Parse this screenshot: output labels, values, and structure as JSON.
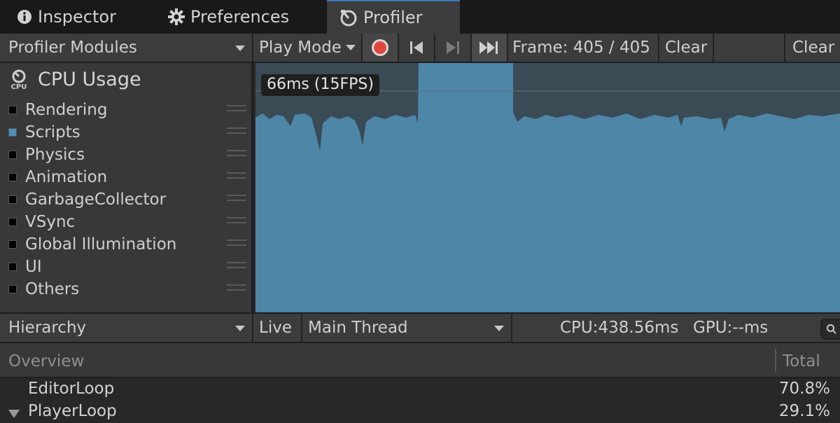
{
  "tabs": [
    {
      "label": "Inspector",
      "icon": "info-icon"
    },
    {
      "label": "Preferences",
      "icon": "gear-icon"
    },
    {
      "label": "Profiler",
      "icon": "profiler-icon",
      "active": true
    }
  ],
  "toolbar": {
    "modules_label": "Profiler Modules",
    "play_mode_label": "Play Mode",
    "frame_label": "Frame: 405 / 405",
    "clear_label": "Clear",
    "clear2_label": "Clear"
  },
  "module": {
    "title": "CPU Usage",
    "icon_text": "CPU",
    "categories": [
      {
        "label": "Rendering",
        "color": "#000000"
      },
      {
        "label": "Scripts",
        "color": "#4f8fbe"
      },
      {
        "label": "Physics",
        "color": "#000000"
      },
      {
        "label": "Animation",
        "color": "#000000"
      },
      {
        "label": "GarbageCollector",
        "color": "#000000"
      },
      {
        "label": "VSync",
        "color": "#000000"
      },
      {
        "label": "Global Illumination",
        "color": "#000000"
      },
      {
        "label": "UI",
        "color": "#000000"
      },
      {
        "label": "Others",
        "color": "#000000"
      }
    ]
  },
  "graph": {
    "fps_label": "66ms (15FPS)",
    "fill_color": "#4e86a8",
    "bg_color": "#3a4b55"
  },
  "details": {
    "view_label": "Hierarchy",
    "live_label": "Live",
    "thread_label": "Main Thread",
    "cpu_label": "CPU:438.56ms",
    "gpu_label": "GPU:--ms"
  },
  "table": {
    "headers": {
      "overview": "Overview",
      "total": "Total"
    },
    "rows": [
      {
        "name": "EditorLoop",
        "total": "70.8%",
        "expandable": false
      },
      {
        "name": "PlayerLoop",
        "total": "29.1%",
        "expandable": true
      }
    ]
  }
}
